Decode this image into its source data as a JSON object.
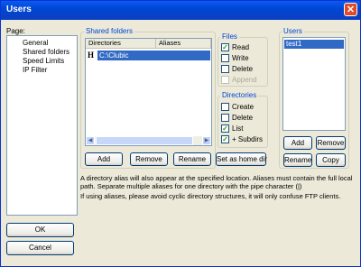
{
  "window": {
    "title": "Users",
    "close_glyph": "✕"
  },
  "page": {
    "label": "Page:",
    "items": [
      {
        "label": "General",
        "selected": false
      },
      {
        "label": "Shared folders",
        "selected": true
      },
      {
        "label": "Speed Limits",
        "selected": false
      },
      {
        "label": "IP Filter",
        "selected": false
      }
    ]
  },
  "shared_folders": {
    "title": "Shared folders",
    "columns": [
      "Directories",
      "Aliases"
    ],
    "rows": [
      {
        "marker": "H",
        "directory": "C:\\Clubic",
        "alias": ""
      }
    ],
    "buttons": {
      "add": "Add",
      "remove": "Remove",
      "rename": "Rename",
      "home": "Set as home dir"
    }
  },
  "files": {
    "title": "Files",
    "options": [
      {
        "label": "Read",
        "checked": true,
        "enabled": true
      },
      {
        "label": "Write",
        "checked": false,
        "enabled": true
      },
      {
        "label": "Delete",
        "checked": false,
        "enabled": true
      },
      {
        "label": "Append",
        "checked": false,
        "enabled": false
      }
    ]
  },
  "directories": {
    "title": "Directories",
    "options": [
      {
        "label": "Create",
        "checked": false,
        "enabled": true
      },
      {
        "label": "Delete",
        "checked": false,
        "enabled": true
      },
      {
        "label": "List",
        "checked": true,
        "enabled": true
      },
      {
        "label": "+ Subdirs",
        "checked": true,
        "enabled": true
      }
    ]
  },
  "users": {
    "title": "Users",
    "items": [
      {
        "label": "test1",
        "selected": true
      }
    ],
    "buttons": {
      "add": "Add",
      "remove": "Remove",
      "rename": "Rename",
      "copy": "Copy"
    }
  },
  "notes": {
    "line1": "A directory alias will also appear at the specified location. Aliases must contain the full local",
    "line2": "path. Separate multiple aliases for one directory with the pipe character (|)",
    "line3": "If using aliases, please avoid cyclic directory structures, it will only confuse FTP clients."
  },
  "footer": {
    "ok": "OK",
    "cancel": "Cancel"
  },
  "colors": {
    "title_bar": "#0046d5",
    "selection": "#316ac5",
    "close": "#e04a27",
    "check": "#21a121"
  }
}
